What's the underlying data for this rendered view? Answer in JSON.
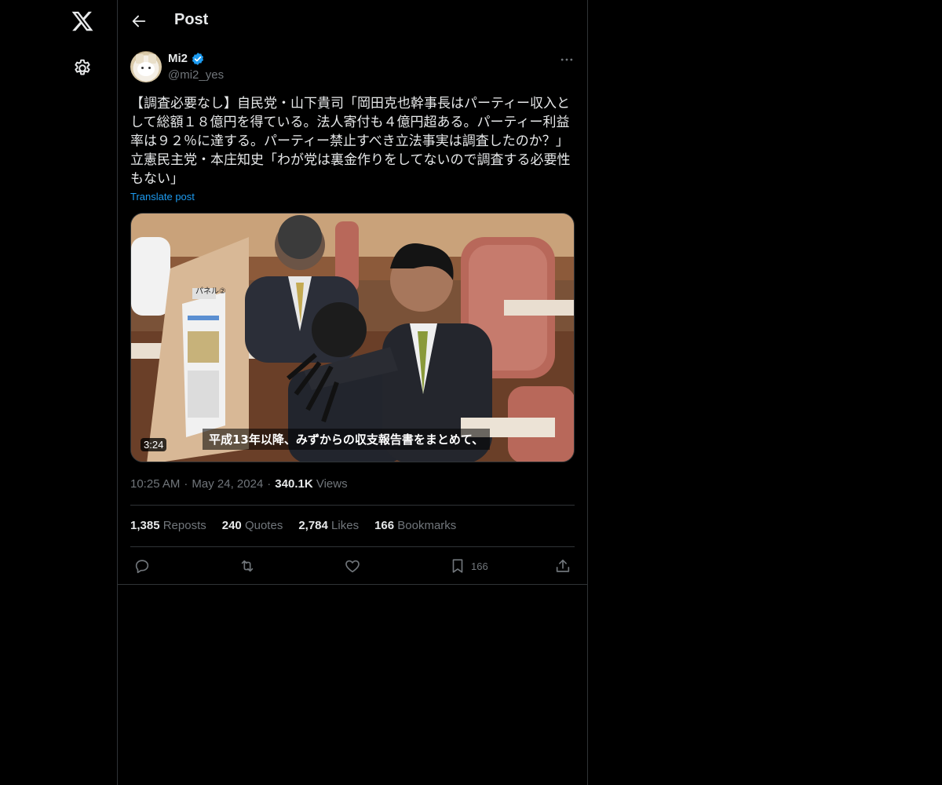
{
  "header": {
    "title": "Post"
  },
  "author": {
    "name": "Mi2",
    "handle": "@mi2_yes",
    "verified": true
  },
  "post": {
    "text": "【調査必要なし】自民党・山下貴司「岡田克也幹事長はパーティー収入と\nして総額１８億円を得ている。法人寄付も４億円超ある。パーティー利益\n率は９２％に達する。パーティー禁止すべき立法事実は調査したのか？」\n立憲民主党・本庄知史「わが党は裏金作りをしてないので調査する必要性\nもない」",
    "translate_label": "Translate post"
  },
  "media": {
    "duration": "3:24",
    "caption": "平成13年以降、みずからの収支報告書をまとめて、",
    "placard_label": "パネル②"
  },
  "meta": {
    "time": "10:25 AM",
    "date": "May 24, 2024",
    "views_count": "340.1K",
    "views_label": "Views"
  },
  "stats": {
    "reposts_count": "1,385",
    "reposts_label": "Reposts",
    "quotes_count": "240",
    "quotes_label": "Quotes",
    "likes_count": "2,784",
    "likes_label": "Likes",
    "bookmarks_count": "166",
    "bookmarks_label": "Bookmarks"
  },
  "actions": {
    "bookmark_count": "166"
  },
  "icons": {
    "logo": "x-logo-icon",
    "settings": "gear-icon",
    "back": "arrow-left-icon",
    "verified": "verified-badge-icon",
    "more": "more-horizontal-icon",
    "reply": "reply-icon",
    "repost": "repost-icon",
    "like": "heart-icon",
    "bookmark": "bookmark-icon",
    "share": "share-icon"
  },
  "colors": {
    "background": "#000000",
    "text": "#e7e9ea",
    "muted": "#71767b",
    "accent": "#1d9bf0",
    "border": "#2f3336"
  }
}
